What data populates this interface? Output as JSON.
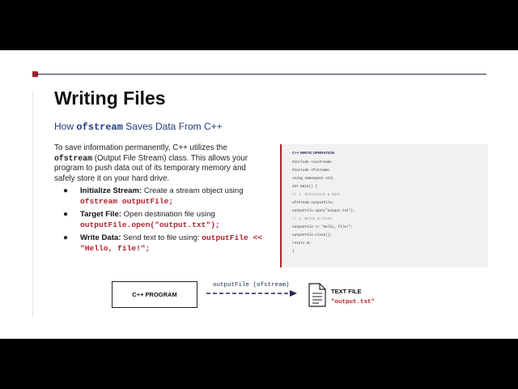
{
  "slide": {
    "title": "Writing Files",
    "subtitle": {
      "prefix": "How ",
      "code": "ofstream",
      "suffix": " Saves Data From C++"
    },
    "intro": {
      "part1": "To save information permanently, C++ utilizes the ",
      "code": "ofstream",
      "part2": " (Output File Stream) class. This allows your program to push data out of its temporary memory and safely store it on your hard drive."
    },
    "bullets": [
      {
        "label": "Initialize Stream:",
        "text": " Create a stream object using ",
        "code": "ofstream outputFile;"
      },
      {
        "label": "Target File:",
        "text": " Open destination file using ",
        "code": "outputFile.open(\"output.txt\");"
      },
      {
        "label": "Write Data:",
        "text": " Send text to file using: ",
        "code": "outputFile << \"Hello, file!\";"
      }
    ],
    "code_panel": {
      "title": "C++ WRITE OPERATION",
      "lines": [
        "#include <iostream>",
        "#include <fstream>",
        "using namespace std;",
        "int main() {",
        "// 1. Initialize & Open",
        "ofstream outputFile;",
        "outputFile.open(\"output.txt\");",
        "// 2. Write & Close",
        "outputFile << \"Hello, file!\";",
        "outputFile.close();",
        "return 0;",
        "}"
      ]
    },
    "diagram": {
      "source_label": "C++ PROGRAM",
      "arrow_label": "outputFile (ofstream)",
      "target_label": "TEXT FILE",
      "target_filename": "\"output.txt\""
    }
  },
  "colors": {
    "accent": "#b3202a",
    "navy": "#1f2a5a",
    "subtitle": "#1f3a7a",
    "background": "#000000",
    "slide": "#ffffff"
  },
  "icons": {
    "bullet": "filled-circle",
    "file": "document-icon",
    "arrow": "dashed-arrow-right"
  }
}
